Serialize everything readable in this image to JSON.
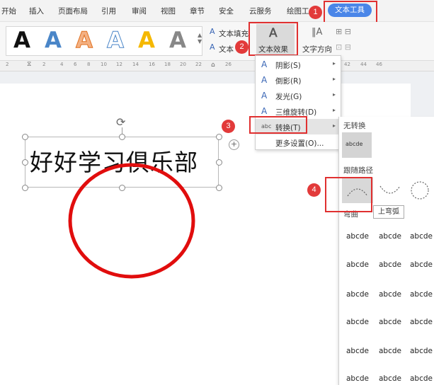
{
  "menubar": {
    "tabs": [
      "开始",
      "插入",
      "页面布局",
      "引用",
      "审阅",
      "视图",
      "章节",
      "安全",
      "云服务",
      "绘图工"
    ],
    "active_tab": "文本工具"
  },
  "toolbar": {
    "gallery_glyph": "A",
    "text_fill": "文本填充",
    "text_outline": "文本",
    "text_effects": "文本效果",
    "text_direction": "文字方向"
  },
  "ruler": {
    "ticks": [
      "2",
      "2",
      "4",
      "6",
      "8",
      "10",
      "12",
      "14",
      "16",
      "18",
      "20",
      "22",
      "26",
      "42",
      "44",
      "46"
    ]
  },
  "document": {
    "art_text": "好好学习俱乐部"
  },
  "dropdown": {
    "items": [
      {
        "icon": "shadow-icon",
        "label": "阴影(S)",
        "has_arrow": true
      },
      {
        "icon": "reflection-icon",
        "label": "倒影(R)",
        "has_arrow": true
      },
      {
        "icon": "glow-icon",
        "label": "发光(G)",
        "has_arrow": true
      },
      {
        "icon": "3d-rotation-icon",
        "label": "三维旋转(D)",
        "has_arrow": true
      },
      {
        "icon": "transform-icon",
        "label": "转换(T)",
        "has_arrow": true
      },
      {
        "icon": "",
        "label": "更多设置(O)...",
        "has_arrow": false
      }
    ],
    "transform_icon_text": "abc"
  },
  "submenu": {
    "no_transform": "无转换",
    "no_transform_sample": "abcde",
    "follow_path": "跟随路径",
    "warp": "弯曲",
    "tooltip": "上弯弧",
    "warp_samples": [
      [
        "abcde",
        "abcde",
        "abcde"
      ],
      [
        "abcde",
        "abcde",
        "abcde"
      ],
      [
        "abcde",
        "abcde",
        "abcde"
      ],
      [
        "abcde",
        "abcde",
        "abcde"
      ],
      [
        "abcde",
        "abcde",
        "abcde"
      ],
      [
        "abcde",
        "abcde",
        "abcde"
      ]
    ]
  },
  "annotations": {
    "badges": [
      "1",
      "2",
      "3",
      "4"
    ]
  },
  "colors": {
    "accent": "#4a86e8",
    "annotation_red": "#e03030",
    "circle_red": "#e10d0d"
  }
}
